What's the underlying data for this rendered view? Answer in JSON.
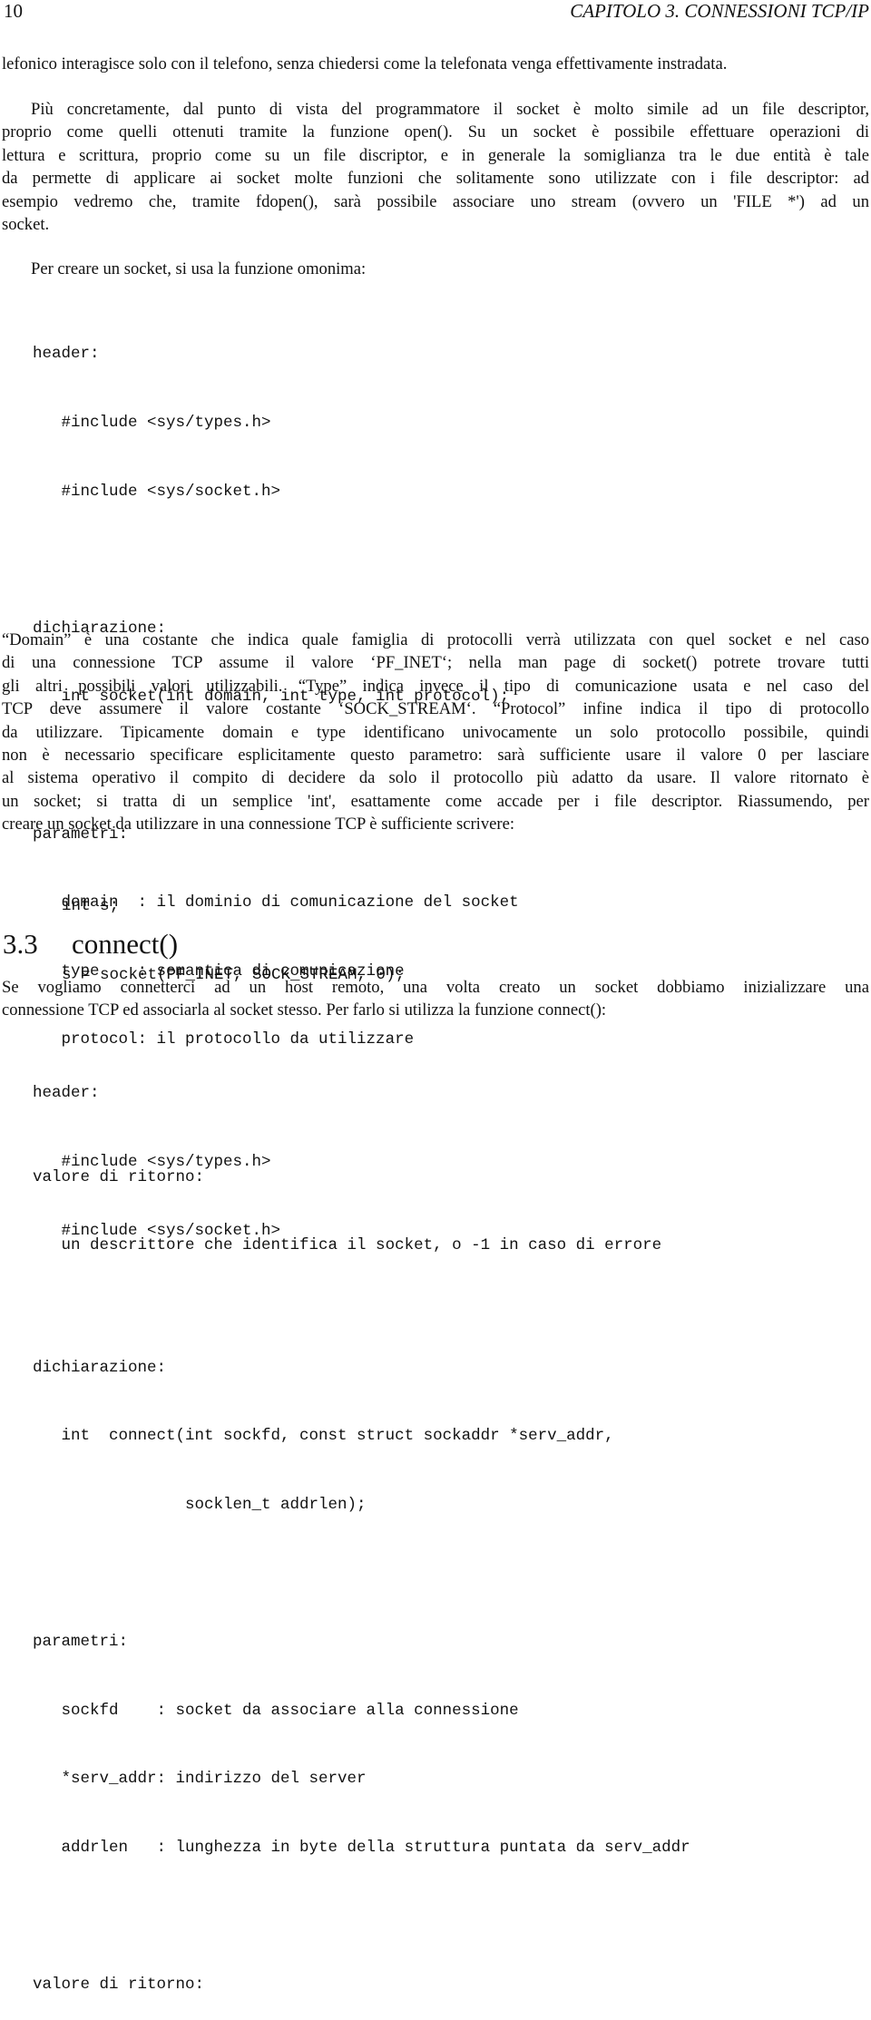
{
  "header": {
    "page_number": "10",
    "chapter_title": "CAPITOLO 3.  CONNESSIONI TCP/IP"
  },
  "intro": {
    "continued_paragraph": [
      "lefonico interagisce solo con il telefono, senza chiedersi come la telefonata venga effettivamente instradata."
    ],
    "paragraph_socket_fd": [
      "Più concretamente, dal punto di vista del programmatore il socket è molto simile ad un file descriptor,",
      "proprio come quelli ottenuti tramite la funzione open(). Su un socket è possibile effettuare operazioni di",
      "lettura e scrittura, proprio come su un file discriptor, e in generale la somiglianza tra le due entità è tale",
      "da permette di applicare ai socket molte funzioni che solitamente sono utilizzate con i file descriptor: ad",
      "esempio vedremo che, tramite fdopen(), sarà possibile associare uno stream (ovvero un 'FILE *') ad un",
      "socket."
    ],
    "paragraph_create": [
      "Per creare un socket, si usa la funzione omonima:"
    ]
  },
  "socket_synopsis": {
    "lines": [
      "header:",
      "   #include <sys/types.h>",
      "   #include <sys/socket.h>",
      "",
      "dichiarazione:",
      "   int socket(int domain, int type, int protocol);",
      "",
      "parametri:",
      "   domain  : il dominio di comunicazione del socket",
      "   type    : semantica di comunicazione",
      "   protocol: il protocollo da utilizzare",
      "",
      "valore di ritorno:",
      "   un descrittore che identifica il socket, o -1 in caso di errore"
    ]
  },
  "explanation": {
    "lines": [
      "“Domain” è una costante che indica quale famiglia di protocolli verrà utilizzata con quel socket e nel caso",
      "di una connessione TCP assume il valore ‘PF_INET‘; nella man page di socket() potrete trovare tutti",
      "gli altri possibili valori utilizzabili.  “Type” indica invece il tipo di comunicazione usata e nel caso del",
      "TCP deve assumere il valore costante ‘SOCK_STREAM‘.  “Protocol” infine indica il tipo di protocollo",
      "da utilizzare. Tipicamente domain e type identificano univocamente un solo protocollo possibile, quindi",
      "non è necessario specificare esplicitamente questo parametro: sarà sufficiente usare il valore 0 per lasciare",
      "al sistema operativo il compito di decidere da solo il protocollo più adatto da usare. Il valore ritornato è",
      "un socket; si tratta di un semplice 'int', esattamente come accade per i file descriptor. Riassumendo, per",
      "creare un socket da utilizzare in una connessione TCP è sufficiente scrivere:"
    ]
  },
  "example_code": {
    "lines": [
      "int s;",
      "s = socket(PF_INET, SOCK_STREAM, 0);"
    ]
  },
  "section": {
    "number": "3.3",
    "title": "connect()"
  },
  "connect_intro": {
    "lines": [
      "Se vogliamo connetterci ad un host remoto, una volta creato un socket dobbiamo inizializzare una",
      "connessione TCP ed associarla al socket stesso. Per farlo si utilizza la funzione connect():"
    ]
  },
  "connect_synopsis": {
    "lines": [
      "header:",
      "   #include <sys/types.h>",
      "   #include <sys/socket.h>",
      "",
      "dichiarazione:",
      "   int  connect(int sockfd, const struct sockaddr *serv_addr,",
      "                socklen_t addrlen);",
      "",
      "parametri:",
      "   sockfd    : socket da associare alla connessione",
      "   *serv_addr: indirizzo del server",
      "   addrlen   : lunghezza in byte della struttura puntata da serv_addr",
      "",
      "valore di ritorno:"
    ]
  }
}
